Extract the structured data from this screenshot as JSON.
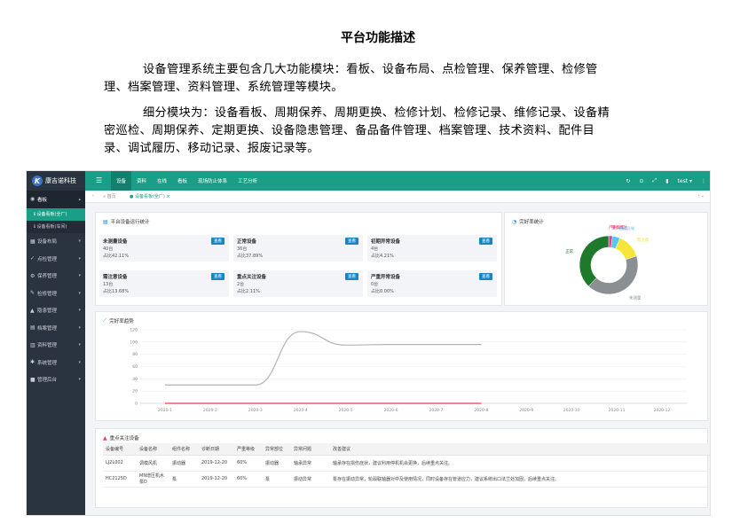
{
  "document": {
    "title": "平台功能描述",
    "paragraph1": "设备管理系统主要包含几大功能模块：看板、设备布局、点检管理、保养管理、检修管理、档案管理、资料管理、系统管理等模块。",
    "paragraph2": "细分模块为：设备看板、周期保养、周期更换、检修计划、检修记录、维修记录、设备精密巡检、周期保养、定期更换、设备隐患管理、备品备件管理、档案管理、技术资料、配件目录、调试履历、移动记录、报废记录等。"
  },
  "app": {
    "brand": "康吉诺科技",
    "logo_letter": "K",
    "top_menu": [
      "设备",
      "资料",
      "在线",
      "看板",
      "现场防止体系",
      "工艺分析"
    ],
    "top_right": {
      "refresh": "↻",
      "user": "test ▾"
    },
    "tabs": {
      "home": "« 首页",
      "current": "● 设备看板(全厂) ×",
      "right": "›  ⌄"
    },
    "sidebar": {
      "head": "看板",
      "subs": [
        "设备看板(全厂)",
        "设备看板(车间)"
      ],
      "items": [
        "设备布局",
        "点检管理",
        "保养管理",
        "检修管理",
        "隐患管理",
        "档案管理",
        "资料管理",
        "系统管理",
        "管理后台"
      ]
    },
    "status_card": {
      "title": "平台设备运行统计",
      "btn_label": "查看",
      "stats": [
        {
          "name": "未测量设备",
          "count": "40台",
          "pct": "占比42.11%"
        },
        {
          "name": "正常设备",
          "count": "36台",
          "pct": "占比37.89%"
        },
        {
          "name": "初期异常设备",
          "count": "4台",
          "pct": "占比4.21%"
        },
        {
          "name": "需注意设备",
          "count": "13台",
          "pct": "占比13.68%"
        },
        {
          "name": "重点关注设备",
          "count": "2台",
          "pct": "占比2.11%"
        },
        {
          "name": "严重异常设备",
          "count": "0台",
          "pct": "占比0.00%"
        }
      ]
    },
    "donut_card": {
      "title": "完好率统计"
    },
    "trend_card": {
      "title": "完好率趋势"
    },
    "attention_card": {
      "title": "重点关注设备"
    },
    "table": {
      "headers": [
        "设备编号",
        "设备名称",
        "组件名称",
        "诊断日期",
        "严重等级",
        "异常部位",
        "异常问题",
        "改善建议"
      ],
      "rows": [
        [
          "LJ2L002",
          "调模风机",
          "振动器",
          "2019-12-20",
          "60%",
          "振动器",
          "轴承异常",
          "轴承存在损伤症状，建议利用停机机会更换，后续重点关注。"
        ],
        [
          "HC2125D",
          "MN增压机水泵D",
          "泵",
          "2019-12-20",
          "60%",
          "泵",
          "振动异常",
          "泵存在振动异常，轮毂联轴器对中及使用情况，同时设备存在管道应力，建议系统出口法兰处加固，后续重点关注。"
        ]
      ]
    }
  },
  "chart_data": [
    {
      "type": "pie",
      "title": "完好率统计",
      "labels": [
        "严重异常",
        "重点关注",
        "初期异常",
        "需注意",
        "未测量",
        "正常"
      ],
      "values": [
        0,
        2,
        4,
        13,
        40,
        36
      ],
      "colors": [
        "#e8414b",
        "#d63ea0",
        "#58c8e8",
        "#f7e63a",
        "#8a8f94",
        "#1e7a2a"
      ]
    },
    {
      "type": "line",
      "title": "完好率趋势",
      "x": [
        "2020-1",
        "2020-2",
        "2020-3",
        "2020-4",
        "2020-5",
        "2020-6",
        "2020-7",
        "2020-8",
        "2020-9",
        "2020-10",
        "2020-11",
        "2020-12"
      ],
      "ylim": [
        0,
        120
      ],
      "yticks": [
        0,
        20,
        40,
        60,
        80,
        100,
        120
      ],
      "series": [
        {
          "values": [
            30,
            30,
            30,
            117,
            95,
            96,
            96,
            96,
            null,
            null,
            null,
            null
          ],
          "color": "#b3b3b3"
        },
        {
          "values": [
            0,
            0,
            0,
            0,
            0,
            0,
            0,
            0,
            null,
            null,
            null,
            null
          ],
          "color": "#e8414b"
        }
      ]
    }
  ]
}
